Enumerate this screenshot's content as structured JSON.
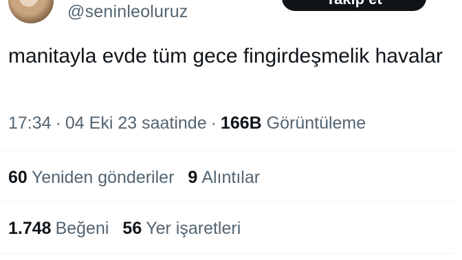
{
  "profile": {
    "handle": "@seninleoluruz",
    "follow_label": "Takip et"
  },
  "tweet": {
    "text": "manitayla evde tüm gece fingirdeşmelik havalar"
  },
  "meta": {
    "time": "17:34",
    "separator": "·",
    "date": "04 Eki 23 saatinde",
    "views_count": "166B",
    "views_label": "Görüntüleme"
  },
  "stats": {
    "reposts_count": "60",
    "reposts_label": "Yeniden gönderiler",
    "quotes_count": "9",
    "quotes_label": "Alıntılar",
    "likes_count": "1.748",
    "likes_label": "Beğeni",
    "bookmarks_count": "56",
    "bookmarks_label": "Yer işaretleri"
  },
  "colors": {
    "text_primary": "#0f1419",
    "text_secondary": "#536471",
    "divider": "#eff3f4",
    "button_bg": "#0f1419"
  }
}
